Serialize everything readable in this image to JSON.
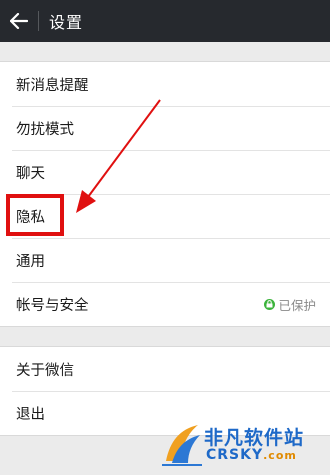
{
  "header": {
    "title": "设置"
  },
  "settings_group_1": [
    {
      "label": "新消息提醒"
    },
    {
      "label": "勿扰模式"
    },
    {
      "label": "聊天"
    },
    {
      "label": "隐私"
    },
    {
      "label": "通用"
    },
    {
      "label": "帐号与安全",
      "status": "已保护"
    }
  ],
  "settings_group_2": [
    {
      "label": "关于微信"
    },
    {
      "label": "退出"
    }
  ],
  "watermark": {
    "name_cn": "非凡软件站",
    "name_en": "CRSKY",
    "suffix": ".com"
  },
  "colors": {
    "header_bg": "#26292e",
    "highlight": "#e01010",
    "protected_green": "#3bb33b"
  }
}
